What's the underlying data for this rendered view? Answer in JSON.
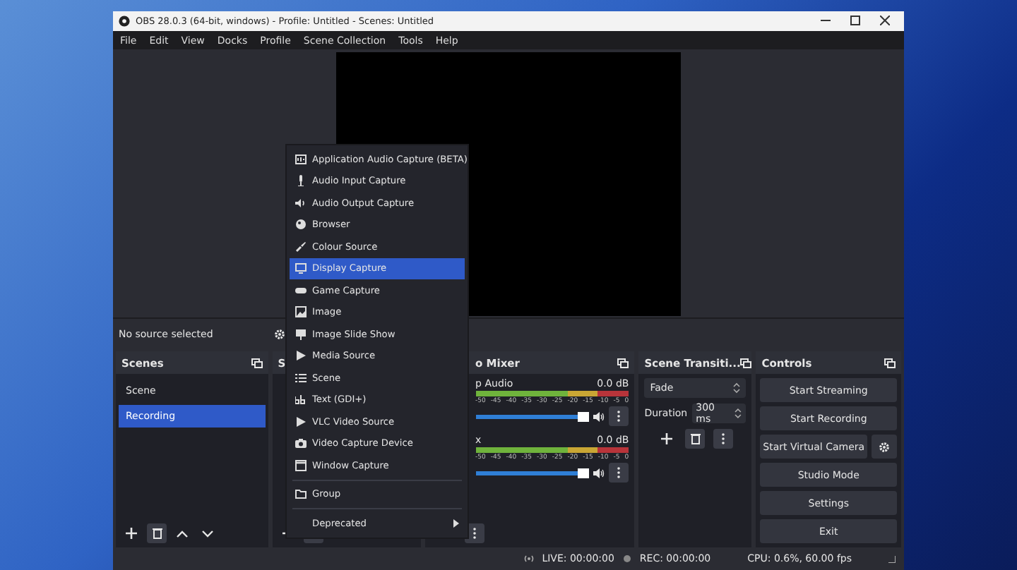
{
  "window": {
    "title": "OBS 28.0.3 (64-bit, windows) - Profile: Untitled - Scenes: Untitled"
  },
  "menu_bar": [
    "File",
    "Edit",
    "View",
    "Docks",
    "Profile",
    "Scene Collection",
    "Tools",
    "Help"
  ],
  "source_bar": {
    "label": "No source selected"
  },
  "scenes": {
    "title": "Scenes",
    "items": [
      {
        "label": "Scene",
        "selected": false
      },
      {
        "label": "Recording",
        "selected": true
      }
    ]
  },
  "sources": {
    "title": "S"
  },
  "audio_mixer": {
    "title": "o Mixer",
    "channels": [
      {
        "name": "p Audio",
        "reading": "0.0 dB",
        "level": 0.95,
        "scale": [
          "-50",
          "-45",
          "-40",
          "-35",
          "-30",
          "-25",
          "-20",
          "-15",
          "-10",
          "-5",
          "0"
        ]
      },
      {
        "name": "x",
        "reading": "0.0 dB",
        "level": 0.95,
        "scale": [
          "-50",
          "-45",
          "-40",
          "-35",
          "-30",
          "-25",
          "-20",
          "-15",
          "-10",
          "-5",
          "0"
        ]
      }
    ]
  },
  "scene_transitions": {
    "title": "Scene Transiti...",
    "transition": "Fade",
    "duration_label": "Duration",
    "duration": "300 ms"
  },
  "controls": {
    "title": "Controls",
    "buttons": [
      {
        "label": "Start Streaming",
        "kind": "plain"
      },
      {
        "label": "Start Recording",
        "kind": "plain"
      },
      {
        "label": "Start Virtual Camera",
        "kind": "with-settings"
      },
      {
        "label": "Studio Mode",
        "kind": "plain"
      },
      {
        "label": "Settings",
        "kind": "plain"
      },
      {
        "label": "Exit",
        "kind": "plain"
      }
    ]
  },
  "context_menu": {
    "sections": [
      [
        {
          "label": "Application Audio Capture (BETA)",
          "selected": false
        },
        {
          "label": "Audio Input Capture",
          "selected": false
        },
        {
          "label": "Audio Output Capture",
          "selected": false
        },
        {
          "label": "Browser",
          "selected": false
        },
        {
          "label": "Colour Source",
          "selected": false
        },
        {
          "label": "Display Capture",
          "selected": true
        },
        {
          "label": "Game Capture",
          "selected": false
        },
        {
          "label": "Image",
          "selected": false
        },
        {
          "label": "Image Slide Show",
          "selected": false
        },
        {
          "label": "Media Source",
          "selected": false
        },
        {
          "label": "Scene",
          "selected": false
        },
        {
          "label": "Text (GDI+)",
          "selected": false
        },
        {
          "label": "VLC Video Source",
          "selected": false
        },
        {
          "label": "Video Capture Device",
          "selected": false
        },
        {
          "label": "Window Capture",
          "selected": false
        }
      ],
      [
        {
          "label": "Group",
          "selected": false
        }
      ],
      [
        {
          "label": "Deprecated",
          "selected": false,
          "submenu": true
        }
      ]
    ]
  },
  "status_bar": {
    "live": "LIVE: 00:00:00",
    "rec": "REC: 00:00:00",
    "cpu": "CPU: 0.6%, 60.00 fps"
  }
}
